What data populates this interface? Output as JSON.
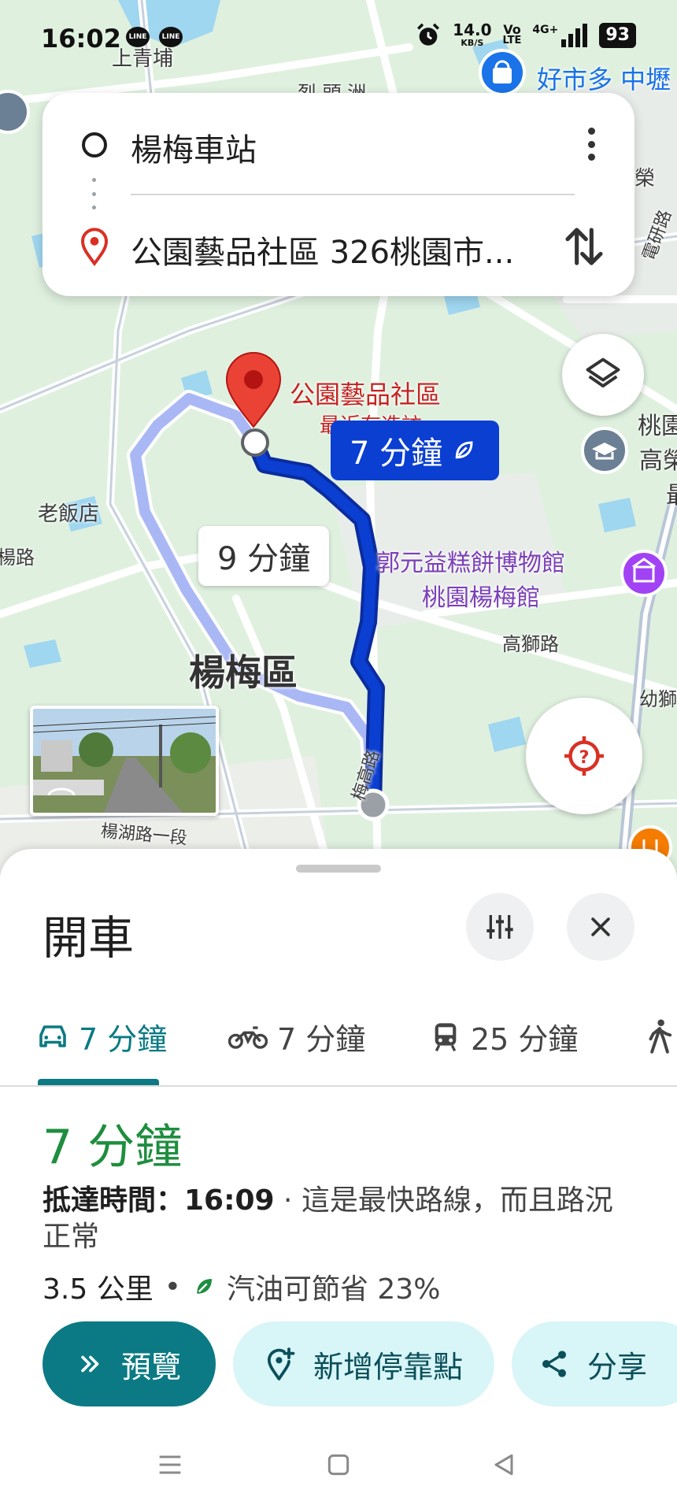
{
  "status_bar": {
    "time": "16:02",
    "line_badge": "LINE",
    "net_speed": "14.0",
    "net_unit": "KB/S",
    "volte_top": "Vo",
    "volte_bottom": "LTE",
    "network": "4G+",
    "battery": "93"
  },
  "route_card": {
    "origin": "楊梅車站",
    "destination": "公園藝品社區 326桃園市..."
  },
  "map": {
    "labels": {
      "shangqingpu": "上青埔",
      "costco": "好市多 中壢",
      "top_partial": "烈 頭 洲",
      "right_partial_1": "榮",
      "road_right": "電研路",
      "dest_name_1": "公園藝品社區",
      "dest_name_2": "最近有造訪",
      "right_partial_2": "桃園",
      "right_partial_3": "高榮",
      "right_partial_4": "最",
      "laofandian": "老飯店",
      "left_road": "楊路",
      "museum_1": "郭元益糕餅博物館",
      "museum_2": "桃園楊梅館",
      "gaoshi_road": "高獅路",
      "district": "楊梅區",
      "right_partial_5": "幼獅",
      "meigao_road": "梅高路",
      "yanghu_road": "楊湖路一段"
    },
    "primary_route_time": "7 分鐘",
    "alt_route_time": "9 分鐘"
  },
  "sheet": {
    "title": "開車",
    "tabs": [
      {
        "label": "7 分鐘",
        "icon": "car-icon",
        "active": true
      },
      {
        "label": "7 分鐘",
        "icon": "motorcycle-icon",
        "active": false
      },
      {
        "label": "25 分鐘",
        "icon": "transit-icon",
        "active": false
      }
    ],
    "duration": "7 分鐘",
    "arrival_label": "抵達時間：16:09",
    "arrival_note": " · 這是最快路線，而且路況正常",
    "distance": "3.5 公里",
    "fuel_saving": "汽油可節省 23%",
    "buttons": {
      "preview": "預覽",
      "add_stop": "新增停靠點",
      "share": "分享"
    }
  },
  "colors": {
    "accent": "#0b7a84",
    "route_primary": "#0b3fd2",
    "route_alt": "#a9b8f5",
    "duration_green": "#1e8e3e",
    "pin_red": "#ea4335"
  }
}
